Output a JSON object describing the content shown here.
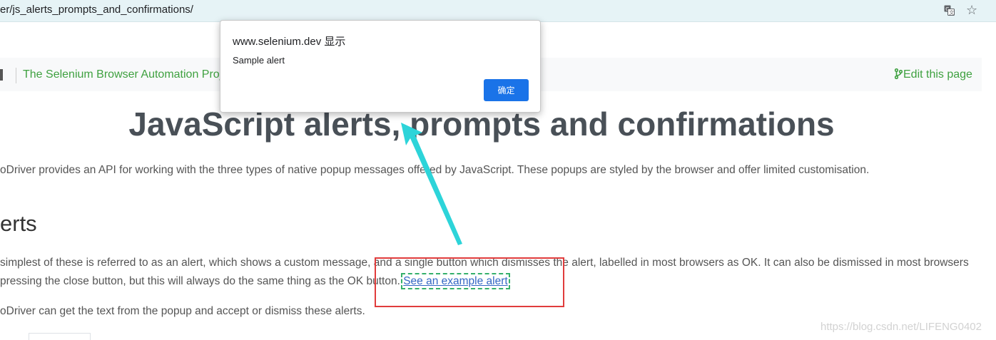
{
  "browser": {
    "url": "er/js_alerts_prompts_and_confirmations/",
    "translate_icon": "translate-icon",
    "bookmark_icon": "star-icon"
  },
  "nav": {
    "breadcrumb": "The Selenium Browser Automation Project",
    "edit_link": "Edit this page"
  },
  "main": {
    "title": "JavaScript alerts, prompts and confirmations",
    "intro": "oDriver provides an API for working with the three types of native popup messages offered by JavaScript. These popups are styled by the browser and offer limited customisation.",
    "section_heading": "erts",
    "para_line1": "simplest of these is referred to as an alert, which shows a custom message, and a single button which dismisses the alert, labelled in most browsers as OK. It can also be dismissed in most browsers",
    "para_line2_prefix": "pressing the close button, but this will always do the same thing as the OK button. ",
    "example_link": "See an example alert",
    "para3": "oDriver can get the text from the popup and accept or dismiss these alerts."
  },
  "alert": {
    "origin": "www.selenium.dev 显示",
    "message": "Sample alert",
    "ok_label": "确定"
  },
  "watermark": "https://blog.csdn.net/LIFENG0402",
  "colors": {
    "accent_green": "#3fa140",
    "link_blue": "#3367c4",
    "dialog_button": "#1a73e8",
    "annotation_red": "#e03c3c",
    "annotation_cyan": "#2dd4d9"
  }
}
